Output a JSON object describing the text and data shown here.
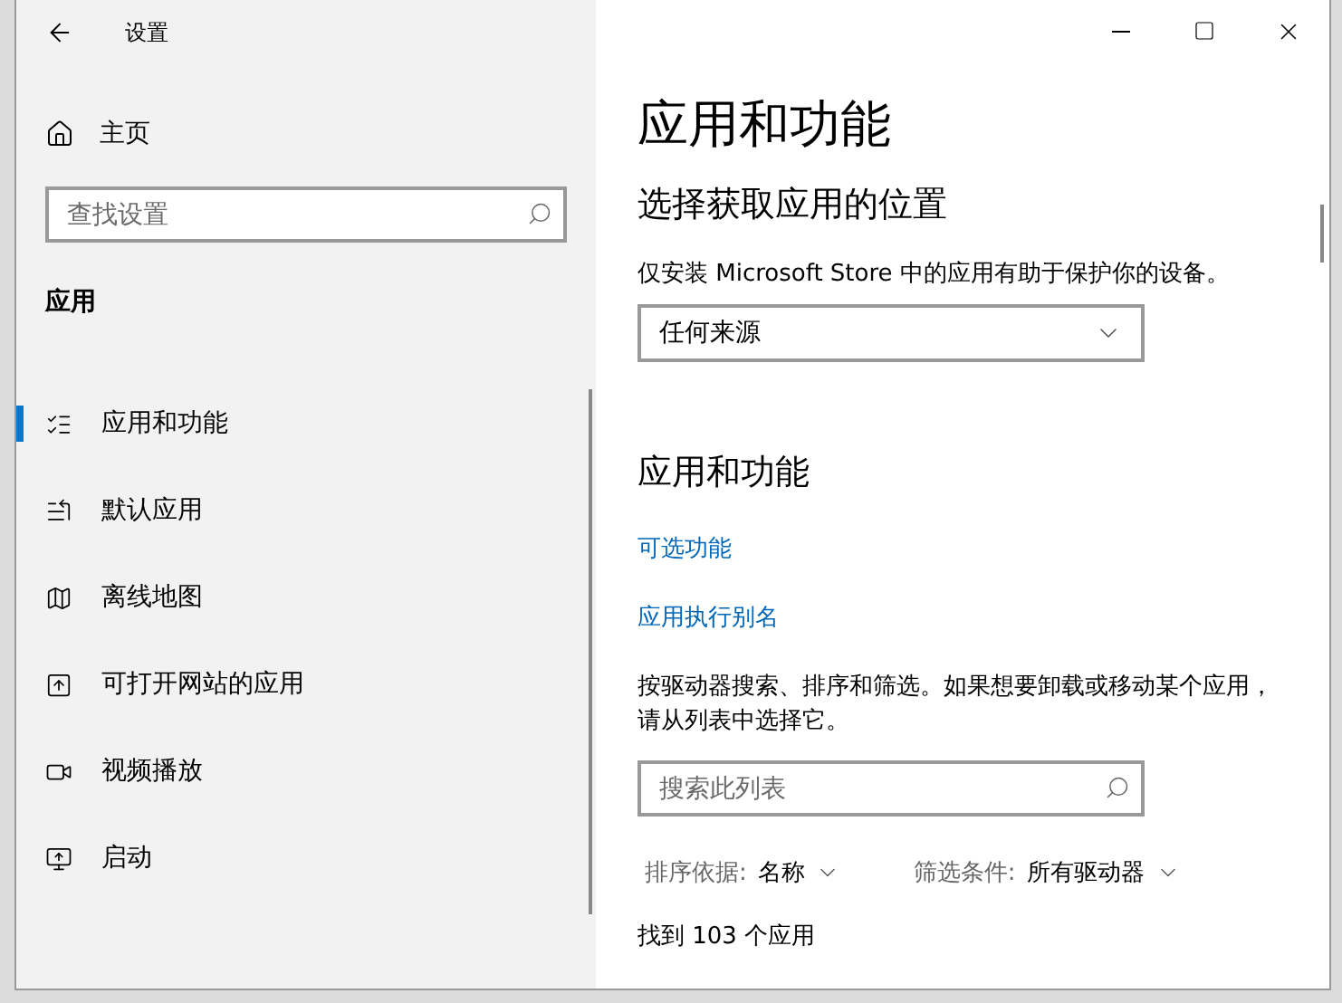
{
  "window": {
    "title": "设置"
  },
  "sidebar": {
    "home": "主页",
    "search": {
      "placeholder": "查找设置"
    },
    "section": "应用",
    "items": [
      {
        "label": "应用和功能",
        "selected": true
      },
      {
        "label": "默认应用",
        "selected": false
      },
      {
        "label": "离线地图",
        "selected": false
      },
      {
        "label": "可打开网站的应用",
        "selected": false
      },
      {
        "label": "视频播放",
        "selected": false
      },
      {
        "label": "启动",
        "selected": false
      }
    ]
  },
  "main": {
    "title": "应用和功能",
    "location_heading": "选择获取应用的位置",
    "location_note": "仅安装 Microsoft Store 中的应用有助于保护你的设备。",
    "source_dropdown": {
      "value": "任何来源"
    },
    "apps_heading": "应用和功能",
    "links": [
      "可选功能",
      "应用执行别名"
    ],
    "description": "按驱动器搜索、排序和筛选。如果想要卸载或移动某个应用，请从列表中选择它。",
    "list_search": {
      "placeholder": "搜索此列表"
    },
    "sort": {
      "label": "排序依据:",
      "value": "名称"
    },
    "filter": {
      "label": "筛选条件:",
      "value": "所有驱动器"
    },
    "count": "找到 103 个应用"
  }
}
